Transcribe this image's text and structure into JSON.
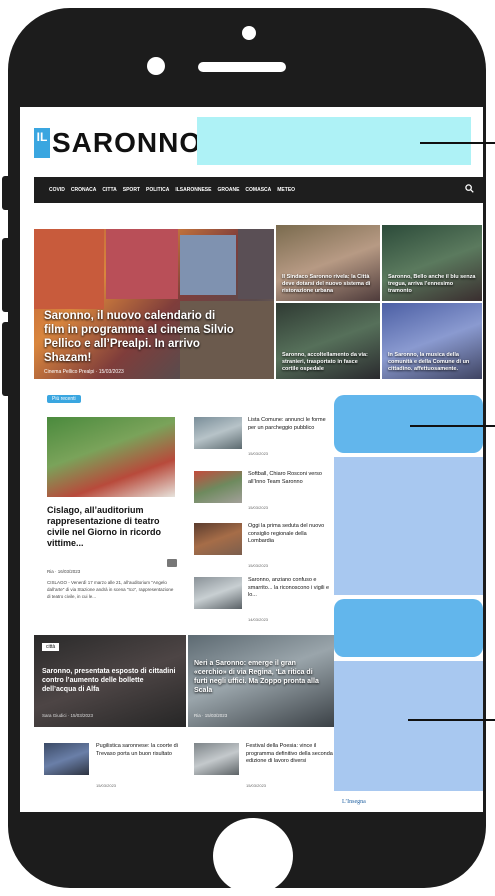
{
  "site": {
    "logo_il": "IL",
    "logo_name": "SARONNO"
  },
  "nav": {
    "items": [
      "COVID",
      "CRONACA",
      "CITTA",
      "SPORT",
      "POLITICA",
      "ILSARONNESE",
      "GROANE",
      "COMASCA",
      "METEO"
    ]
  },
  "hero": {
    "title": "Saronno, il nuovo calendario di film in programma al cinema Silvio Pellico e all’Prealpi. In arrivo Shazam!",
    "meta": "Cinema Pellico Prealpi · 15/03/2023"
  },
  "tiles": [
    {
      "title": "Il Sindaco Saronno rivela: la Città deve dotarsi del nuovo sistema di ristorazione urbana"
    },
    {
      "title": "Saronno, Bello anche il blu senza tregua, arriva l’ennesimo tramonto"
    },
    {
      "title": "Saronno, accoltellamento da via: stranieri, trasportato in fasce cortile ospedale"
    },
    {
      "title": "In Saronno, la musica della comunità e della Comune di un cittadino. affettuosamente."
    }
  ],
  "section_badge": "Più recenti",
  "main_story": {
    "title": "Cislago, all’auditorium rappresentazione di teatro civile nel Giorno in ricordo vittime...",
    "meta": "Ria · 16/03/2023",
    "excerpt": "CISLAGO - Venerdì 17 marzo alle 21, all’auditorium \"Angelo dall’arte\" di via Stazione andrà in scena \"Ico\", rappresentazione di teatro civile, in cui le..."
  },
  "side_list": [
    {
      "title": "Lista Comune: annunci le forme per un parcheggio pubblico",
      "date": "15/03/2023"
    },
    {
      "title": "Softball, Chiaro Rosconi verso all’Inno Team Saronno",
      "date": "15/03/2023"
    },
    {
      "title": "Oggi la prima seduta del nuovo consiglio regionale della Lombardia",
      "date": "15/03/2023"
    },
    {
      "title": "Saronno, anziano confuso e smarrito... la riconoscono i vigili e lo...",
      "date": "14/03/2023"
    }
  ],
  "dark_cards": [
    {
      "tag": "città",
      "title": "Saronno, presentata esposto di cittadini contro l’aumento delle bollette dell’acqua di Alfa",
      "meta": "Sara Giudici · 15/03/2023"
    },
    {
      "title": "Neri a Saronno: emerge il gran «cerchio» di via Regina, ‘La ritica di furti negli uffici. Ma Zoppo pronta alla Scala",
      "meta": "Ria · 15/03/2023"
    }
  ],
  "bottom_list": [
    {
      "title": "Pugilistica saronnese: la coorte di Trevaso porta un buon risultato",
      "date": "15/03/2023"
    },
    {
      "title": "Festival della Poesia: vince il programma definitivo della seconda edizione di lavoro diversi",
      "date": "15/03/2023"
    }
  ],
  "footer_partial": "L’Insegna",
  "colors": {
    "accent": "#3aa6e0",
    "ad_cyan": "#aef2f6",
    "ad_blue": "#a8c8f0",
    "ad_blue_bright": "#62b6ec",
    "nav_bg": "#1e1e1e",
    "phone": "#1c1c1c"
  }
}
